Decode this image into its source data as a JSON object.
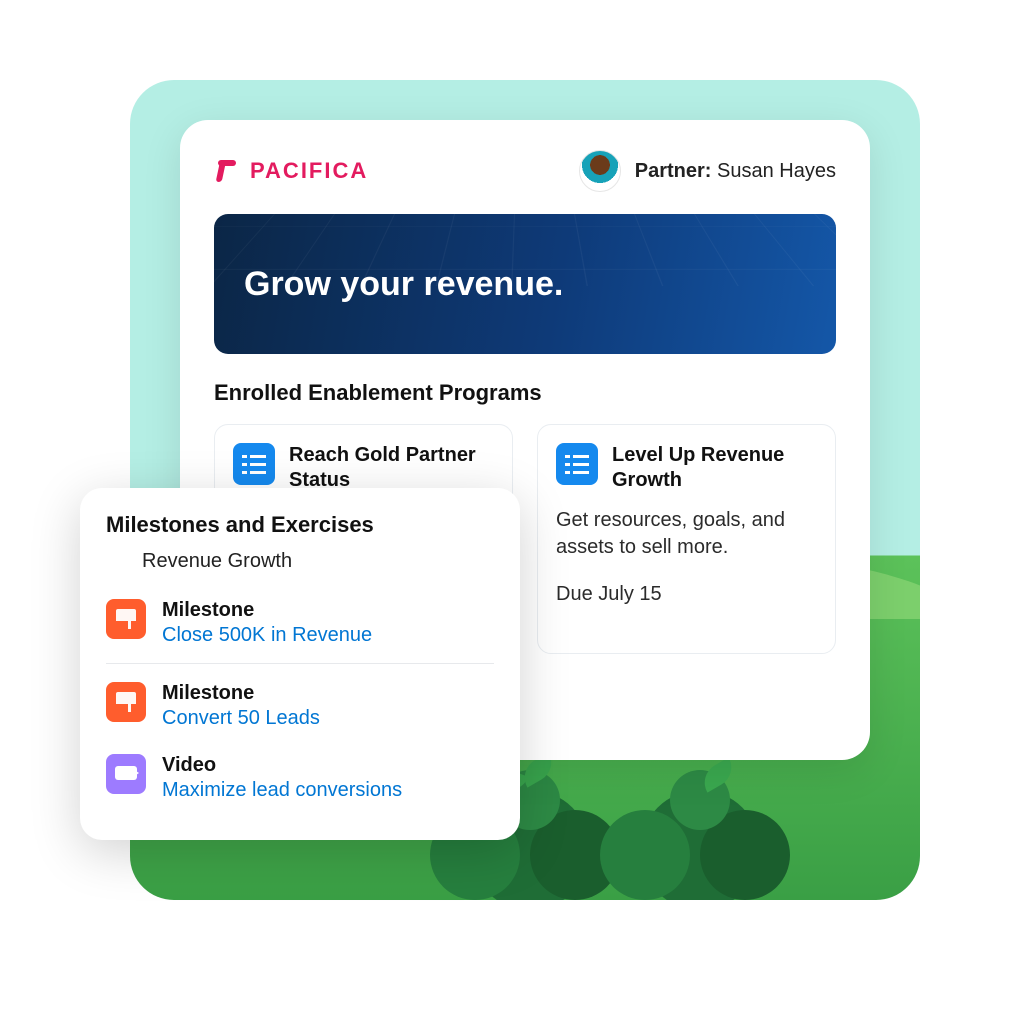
{
  "brand": {
    "name": "PACIFICA"
  },
  "partner": {
    "label": "Partner:",
    "name": "Susan Hayes"
  },
  "hero": {
    "headline": "Grow your revenue."
  },
  "section_title": "Enrolled Enablement Programs",
  "programs": [
    {
      "title": "Reach Gold Partner Status"
    },
    {
      "title": "Level Up Revenue Growth",
      "desc": "Get resources, goals, and assets to sell more.",
      "due": "Due July 15"
    }
  ],
  "milestones_panel": {
    "title": "Milestones and Exercises",
    "subtitle": "Revenue Growth",
    "items": [
      {
        "type": "Milestone",
        "link": "Close 500K in Revenue",
        "icon": "orange"
      },
      {
        "type": "Milestone",
        "link": "Convert 50 Leads",
        "icon": "orange"
      },
      {
        "type": "Video",
        "link": "Maximize lead conversions",
        "icon": "purple"
      }
    ]
  }
}
